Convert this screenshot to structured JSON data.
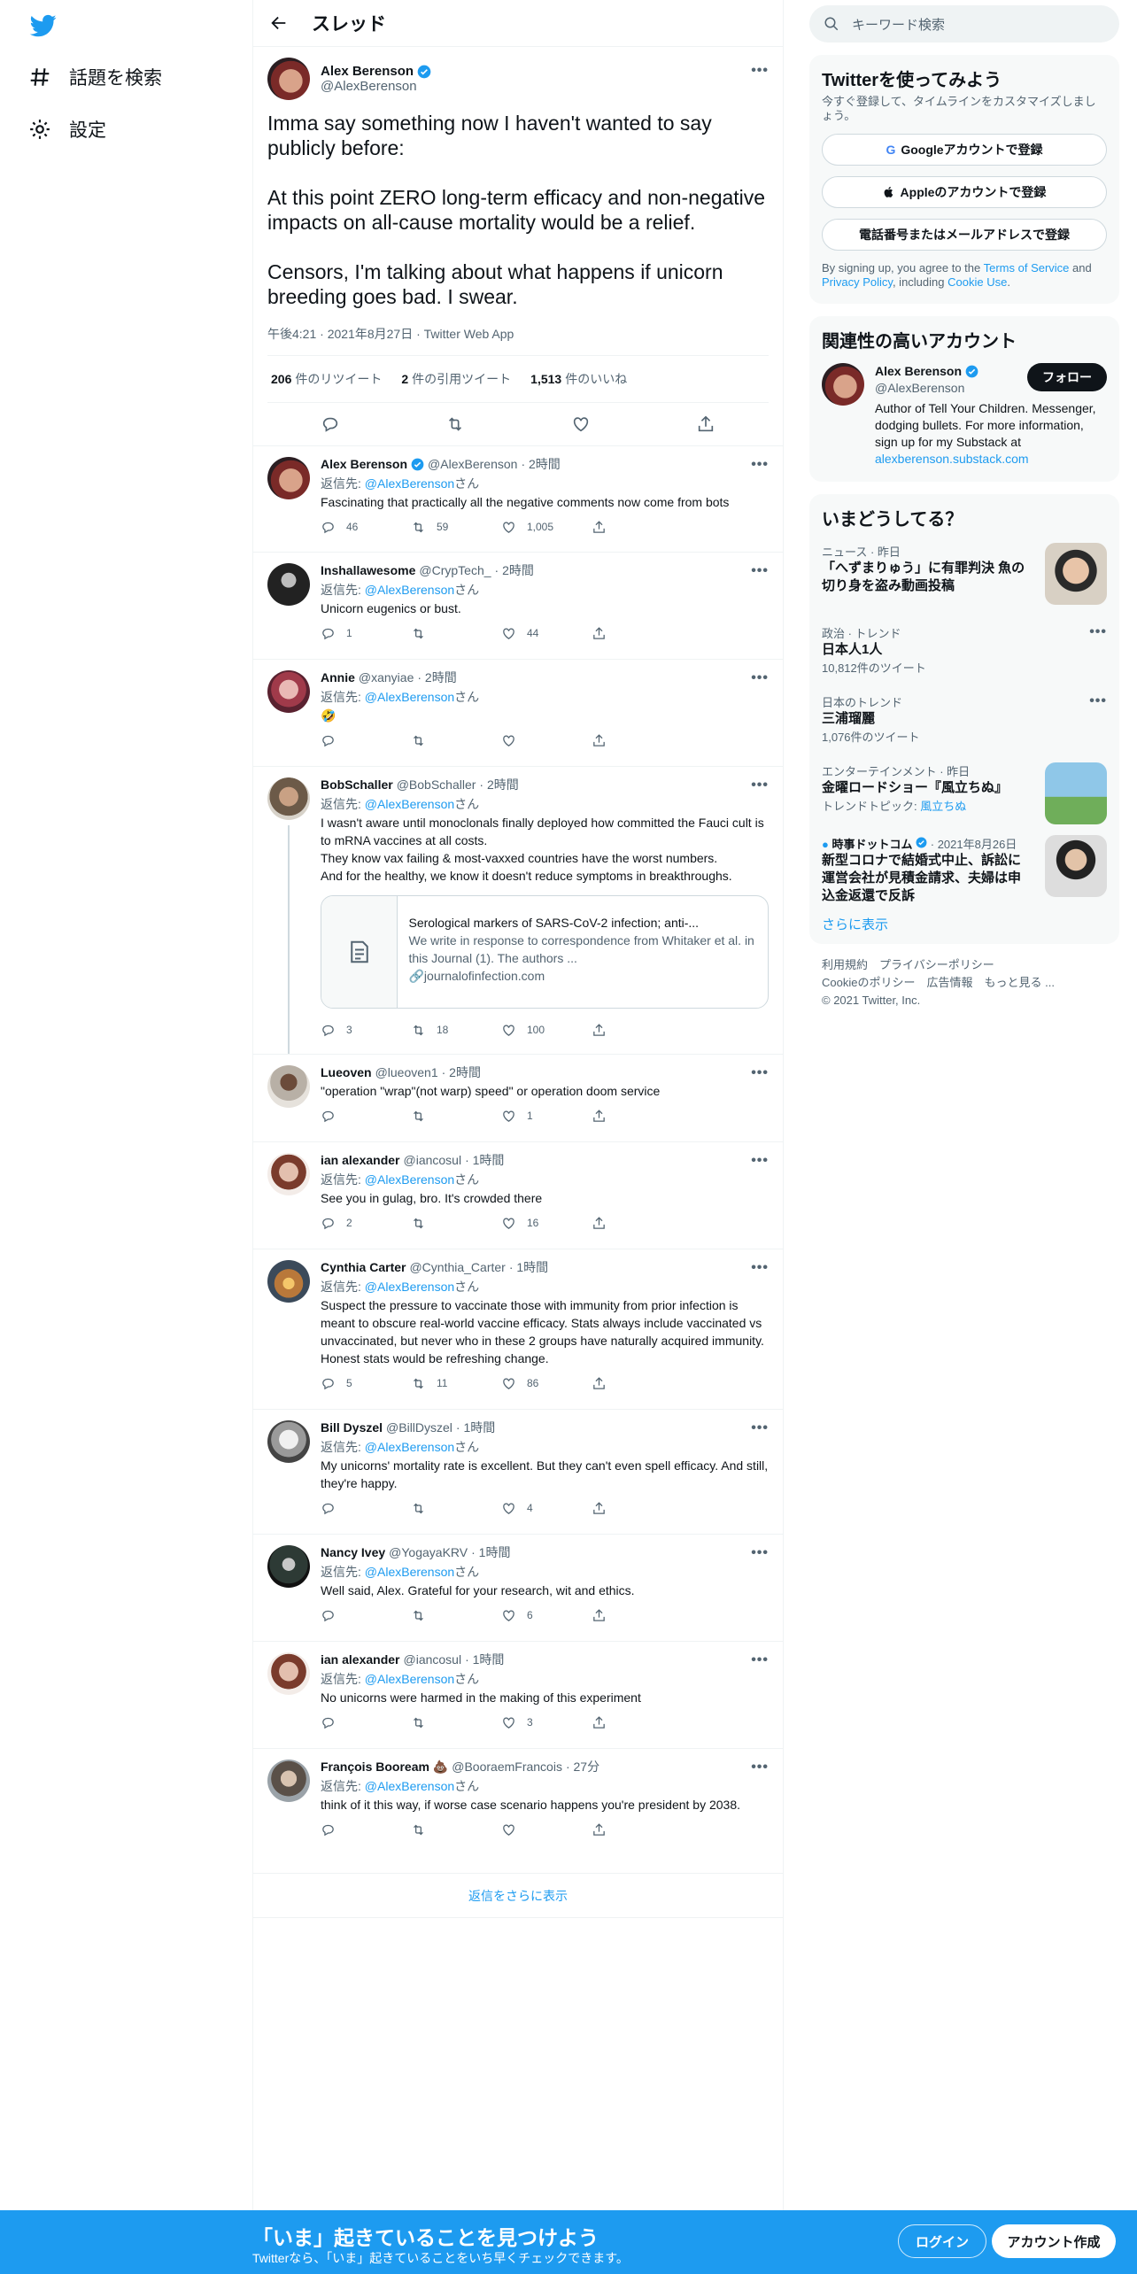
{
  "nav": {
    "explore_label": "話題を検索",
    "settings_label": "設定"
  },
  "header": {
    "title": "スレッド"
  },
  "main_tweet": {
    "name": "Alex Berenson",
    "handle": "@AlexBerenson",
    "text": "Imma say something now I haven't wanted to say publicly before:\n\nAt this point ZERO long-term efficacy and non-negative impacts on all-cause mortality would be a relief.\n\nCensors, I'm talking about what happens if unicorn breeding goes bad. I swear.",
    "meta": "午後4:21 · 2021年8月27日 · Twitter Web App",
    "retweets_num": "206",
    "retweets_label": "件のリツイート",
    "quotes_num": "2",
    "quotes_label": "件の引用ツイート",
    "likes_num": "1,513",
    "likes_label": "件のいいね"
  },
  "reply_to_prefix": "返信先: ",
  "reply_to_link": "@AlexBerenson",
  "reply_to_suffix": "さん",
  "replies": [
    {
      "name": "Alex Berenson",
      "handle": "@AlexBerenson",
      "time": "· 2時間",
      "text": "Fascinating that practically all the negative comments now come from bots",
      "reply": "46",
      "rt": "59",
      "like": "1,005"
    },
    {
      "name": "Inshallawesome",
      "handle": "@CrypTech_",
      "time": "· 2時間",
      "text": "Unicorn eugenics or bust.",
      "reply": "1",
      "rt": "",
      "like": "44"
    },
    {
      "name": "Annie",
      "handle": "@xanyiae",
      "time": "· 2時間",
      "text": "🤣",
      "reply": "",
      "rt": "",
      "like": ""
    },
    {
      "name": "BobSchaller",
      "handle": "@BobSchaller",
      "time": "· 2時間",
      "text": "I wasn't aware until monoclonals finally deployed how committed the Fauci cult is to mRNA vaccines at all costs.\nThey know vax failing & most-vaxxed countries have the worst numbers.\nAnd for the healthy, we know it doesn't reduce symptoms in breakthroughs.",
      "reply": "3",
      "rt": "18",
      "like": "100",
      "card": {
        "title": "Serological markers of SARS-CoV-2 infection; anti-...",
        "desc": "We write in response to correspondence from Whitaker et al. in this Journal (1). The authors ...",
        "url": "journalofinfection.com"
      }
    },
    {
      "name": "Lueoven",
      "handle": "@lueoven1",
      "time": "· 2時間",
      "text": "\"operation \"wrap\"(not warp) speed\" or operation doom service",
      "reply": "",
      "rt": "",
      "like": "1"
    },
    {
      "name": "ian alexander",
      "handle": "@iancosul",
      "time": "· 1時間",
      "text": "See you in gulag, bro. It's crowded there",
      "reply": "2",
      "rt": "",
      "like": "16"
    },
    {
      "name": "Cynthia Carter",
      "handle": "@Cynthia_Carter",
      "time": "· 1時間",
      "text": "Suspect the pressure to vaccinate those with immunity from prior infection is meant to obscure real-world vaccine efficacy. Stats always include vaccinated vs unvaccinated, but never who in these 2 groups have naturally acquired immunity. Honest stats would be refreshing change.",
      "reply": "5",
      "rt": "11",
      "like": "86"
    },
    {
      "name": "Bill Dyszel",
      "handle": "@BillDyszel",
      "time": "· 1時間",
      "text": "My unicorns' mortality rate is excellent. But they can't even spell efficacy. And still, they're happy.",
      "reply": "",
      "rt": "",
      "like": "4"
    },
    {
      "name": "Nancy Ivey",
      "handle": "@YogayaKRV",
      "time": "· 1時間",
      "text": "Well said, Alex. Grateful for your research, wit and ethics.",
      "reply": "",
      "rt": "",
      "like": "6"
    },
    {
      "name": "ian alexander",
      "handle": "@iancosul",
      "time": "· 1時間",
      "text": "No unicorns were harmed in the making of this experiment",
      "reply": "",
      "rt": "",
      "like": "3"
    },
    {
      "name": "François Booream 💩",
      "handle": "@BooraemFrancois",
      "time": "· 27分",
      "text": "think of it this way, if worse case scenario happens you're president by 2038.",
      "reply": "",
      "rt": "",
      "like": ""
    }
  ],
  "show_more_replies": "返信をさらに表示",
  "right": {
    "search_placeholder": "キーワード検索",
    "signup_title": "Twitterを使ってみよう",
    "signup_sub": "今すぐ登録して、タイムラインをカスタマイズしましょう。",
    "google_btn": "Googleアカウントで登録",
    "apple_btn": "Appleのアカウントで登録",
    "phone_btn": "電話番号またはメールアドレスで登録",
    "terms_1": "By signing up, you agree to the ",
    "terms_tos": "Terms of Service",
    "terms_2": " and ",
    "terms_privacy": "Privacy Policy",
    "terms_3": ", including ",
    "terms_cookie": "Cookie Use",
    "terms_4": ".",
    "related_title": "関連性の高いアカウント",
    "related_name": "Alex Berenson",
    "related_handle": "@AlexBerenson",
    "related_bio": "Author of Tell Your Children. Messenger, dodging bullets. For more information, sign up for my Substack at ",
    "related_link": "alexberenson.substack.com",
    "follow_label": "フォロー",
    "trends_title": "いまどうしてる？",
    "trends": [
      {
        "cat": "ニュース · 昨日",
        "title": "「へずまりゅう」に有罪判決 魚の切り身を盗み動画投稿",
        "cnt": ""
      },
      {
        "cat": "政治 · トレンド",
        "title": "日本人1人",
        "cnt": "10,812件のツイート"
      },
      {
        "cat": "日本のトレンド",
        "title": "三浦瑠麗",
        "cnt": "1,076件のツイート"
      },
      {
        "cat": "エンターテインメント · 昨日",
        "title": "金曜ロードショー『風立ちぬ』",
        "cnt": "トレンドトピック: ",
        "topic": "風立ちぬ"
      },
      {
        "cat": "時事ドットコム",
        "date": "· 2021年8月26日",
        "title": "新型コロナで結婚式中止、訴訟に　運営会社が見積金請求、夫婦は申込金返還で反訴",
        "cnt": ""
      }
    ],
    "show_more": "さらに表示",
    "footer": [
      "利用規約",
      "プライバシーポリシー",
      "Cookieのポリシー",
      "広告情報",
      "もっと見る ...",
      "© 2021 Twitter, Inc."
    ]
  },
  "bottom": {
    "title": "「いま」起きていることを見つけよう",
    "sub": "Twitterなら、「いま」起きていることをいち早くチェックできます。",
    "login": "ログイン",
    "signup": "アカウント作成"
  }
}
